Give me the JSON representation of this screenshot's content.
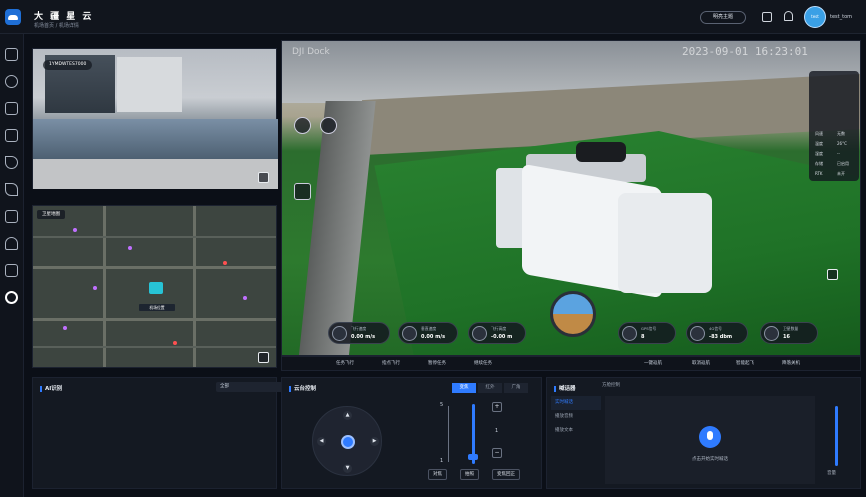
{
  "header": {
    "title": "大 疆 星 云",
    "breadcrumb": "机场首页 / 机场详情",
    "mode_button": "明亮主题",
    "avatar_text": "test",
    "username": "test_tom"
  },
  "sidebar": {
    "icons": [
      "home-icon",
      "signal-icon",
      "image-icon",
      "grid-icon",
      "send-icon",
      "paper-plane-icon",
      "storage-icon",
      "user-icon",
      "network-icon",
      "gear-icon"
    ],
    "active_index": 9
  },
  "camera1": {
    "label": "1YMDWTES7000"
  },
  "map": {
    "layer_label": "卫星地图",
    "home_label": "机场位置"
  },
  "live": {
    "watermark_left": "DJI Dock",
    "timestamp": "2023-09-01 16:23:01",
    "hud": {
      "rows": [
        [
          "风速",
          "无数"
        ],
        [
          "温度",
          "26°C"
        ],
        [
          "湿度",
          "--"
        ],
        [
          "存储",
          "已启用"
        ],
        [
          "RTK",
          "未开"
        ]
      ]
    },
    "gauges": [
      {
        "label": "飞行速度",
        "value": "0.00 m/s"
      },
      {
        "label": "垂直速度",
        "value": "0.00 m/s"
      },
      {
        "label": "飞行高度",
        "value": "-0.00 m"
      },
      {
        "label": "GPS信号",
        "value": "8"
      },
      {
        "label": "4G信号",
        "value": "-83 dbm"
      },
      {
        "label": "卫星数量",
        "value": "16"
      }
    ]
  },
  "toolbar": {
    "items": [
      "任务飞行",
      "指点飞行",
      "暂停任务",
      "继续任务",
      "一键返航",
      "取消返航",
      "智能起飞",
      "降落关机"
    ]
  },
  "ai_panel": {
    "title": "AI识别",
    "select_value": "全部"
  },
  "gimbal_panel": {
    "title": "云台控制",
    "tabs": [
      "变焦",
      "红外",
      "广角"
    ],
    "active_tab": 0,
    "zoom_max": "5",
    "zoom_min": "1",
    "zoom_value": "1",
    "buttons": [
      "对焦",
      "拍照",
      "变焦回正"
    ]
  },
  "speaker_panel": {
    "title": "喊话器",
    "tab": "方舱控制",
    "side_items": [
      "实时喊话",
      "播放音频",
      "播放文本"
    ],
    "active_side": 0,
    "mic_hint": "点击开始实时喊话",
    "volume_label": "音量"
  }
}
